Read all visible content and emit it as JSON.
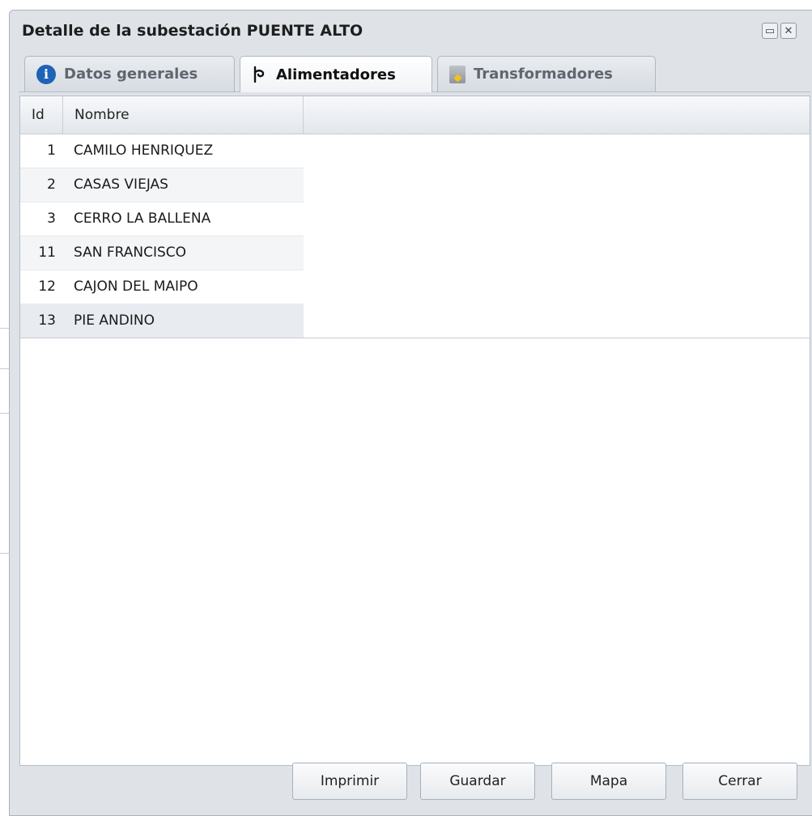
{
  "window": {
    "title": "Detalle de la subestación PUENTE ALTO"
  },
  "tabs": [
    {
      "label": "Datos generales",
      "icon": "info-icon",
      "active": false
    },
    {
      "label": "Alimentadores",
      "icon": "feeder-icon",
      "active": true
    },
    {
      "label": "Transformadores",
      "icon": "transformer-icon",
      "active": false
    }
  ],
  "grid": {
    "columns": [
      "Id",
      "Nombre"
    ],
    "rows": [
      {
        "id": "1",
        "name": "CAMILO HENRIQUEZ"
      },
      {
        "id": "2",
        "name": "CASAS VIEJAS"
      },
      {
        "id": "3",
        "name": "CERRO LA BALLENA"
      },
      {
        "id": "11",
        "name": "SAN FRANCISCO"
      },
      {
        "id": "12",
        "name": "CAJON DEL MAIPO"
      },
      {
        "id": "13",
        "name": "PIE ANDINO"
      }
    ],
    "selected_row": "13"
  },
  "buttons": {
    "print": "Imprimir",
    "save": "Guardar",
    "map": "Mapa",
    "close": "Cerrar"
  },
  "colors": {
    "info_icon": "#1f63b6",
    "window_bg": "#dfe3e8"
  }
}
